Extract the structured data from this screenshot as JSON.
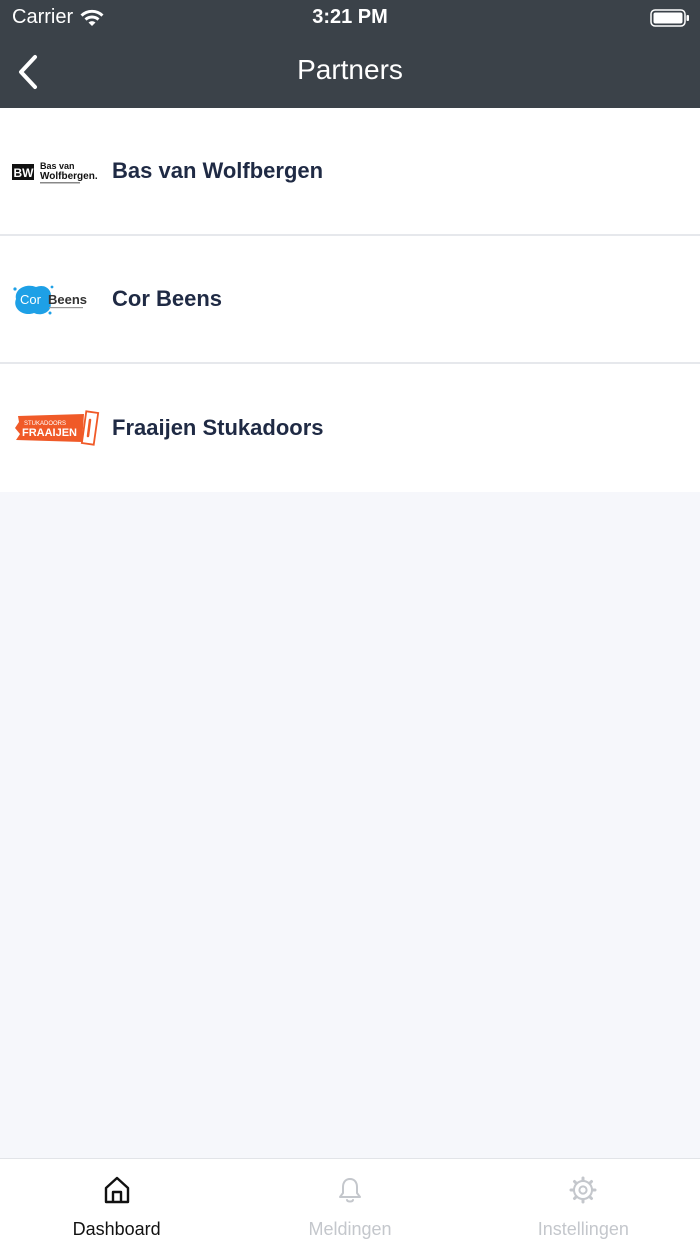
{
  "status_bar": {
    "carrier": "Carrier",
    "time": "3:21 PM",
    "wifi_icon": "wifi-icon",
    "battery_icon": "battery-icon"
  },
  "nav": {
    "title": "Partners",
    "back_icon": "chevron-left-icon"
  },
  "partners": [
    {
      "name": "Bas van Wolfbergen",
      "logo_text": [
        "BW",
        "Bas van",
        "Wolfbergen."
      ]
    },
    {
      "name": "Cor Beens",
      "logo_text": [
        "Cor",
        "Beens"
      ]
    },
    {
      "name": "Fraaijen Stukadoors",
      "logo_text": [
        "STUKADOORS",
        "FRAAIJEN"
      ]
    }
  ],
  "tabs": [
    {
      "label": "Dashboard",
      "icon": "home-icon",
      "active": true
    },
    {
      "label": "Meldingen",
      "icon": "bell-icon",
      "active": false
    },
    {
      "label": "Instellingen",
      "icon": "gear-icon",
      "active": false
    }
  ],
  "colors": {
    "header_bg": "#3b4249",
    "page_bg": "#f6f7fb",
    "text_primary": "#1f2a44",
    "tab_inactive": "#c4c7cc",
    "cor_beens_blue": "#1ea0e6",
    "fraaijen_orange": "#f05a28"
  }
}
